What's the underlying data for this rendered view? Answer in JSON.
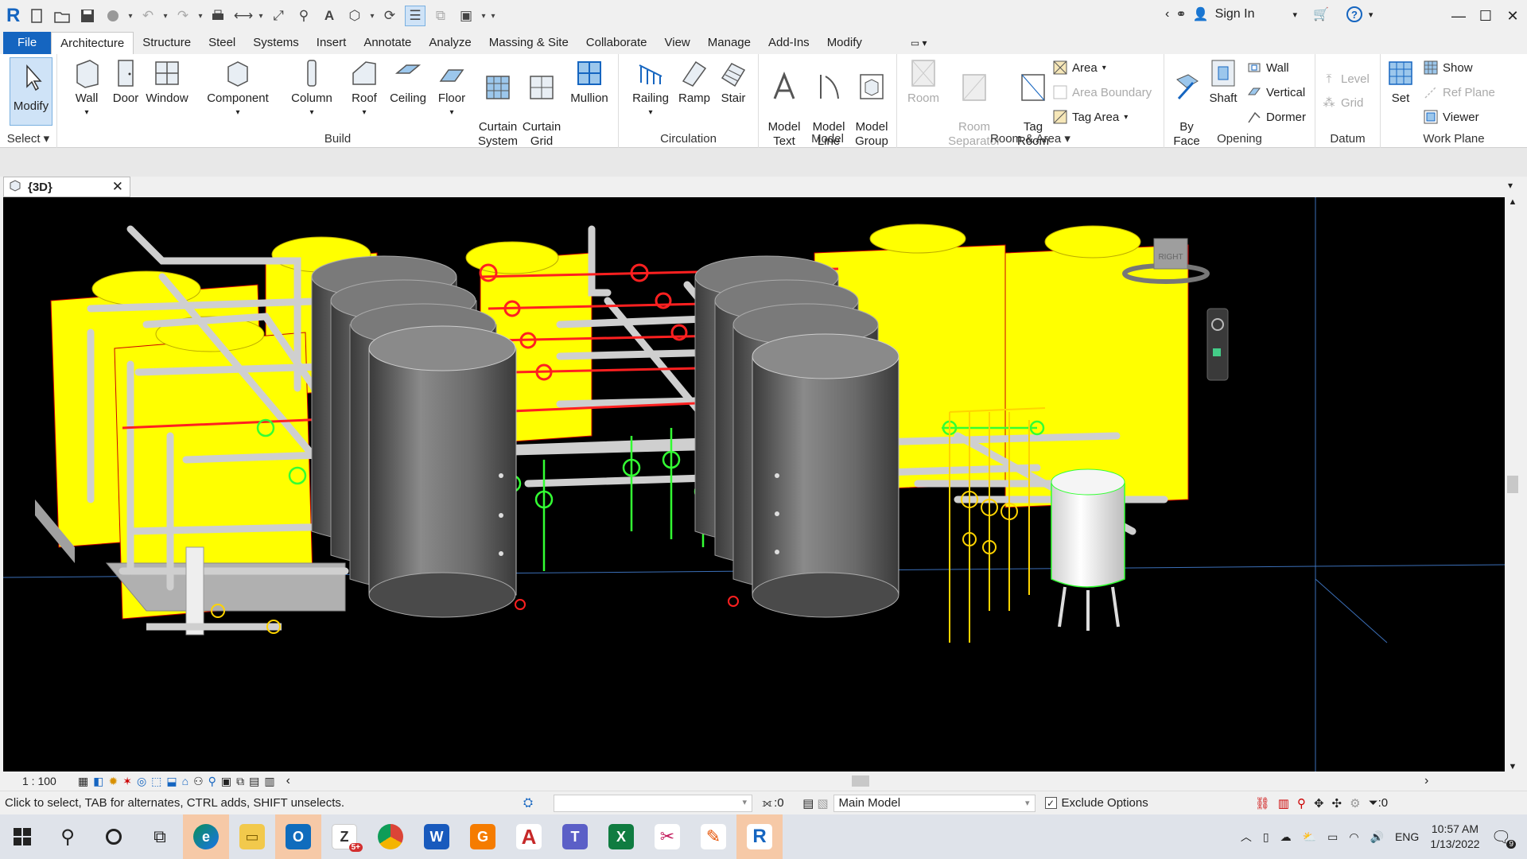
{
  "qat": {
    "help_label": "?",
    "signin": "Sign In"
  },
  "tabs": [
    "File",
    "Architecture",
    "Structure",
    "Steel",
    "Systems",
    "Insert",
    "Annotate",
    "Analyze",
    "Massing & Site",
    "Collaborate",
    "View",
    "Manage",
    "Add-Ins",
    "Modify"
  ],
  "ribbon": {
    "select": {
      "modify": "Modify",
      "select": "Select"
    },
    "build": {
      "label": "Build",
      "tools": [
        "Wall",
        "Door",
        "Window",
        "Component",
        "Column",
        "Roof",
        "Ceiling",
        "Floor",
        "Curtain\nSystem",
        "Curtain\nGrid",
        "Mullion"
      ]
    },
    "circulation": {
      "label": "Circulation",
      "tools": [
        "Railing",
        "Ramp",
        "Stair"
      ]
    },
    "model": {
      "label": "Model",
      "tools": [
        "Model\nText",
        "Model\nLine",
        "Model\nGroup"
      ]
    },
    "room_area": {
      "label": "Room & Area",
      "room": "Room",
      "room_separator": "Room\nSeparator",
      "tag_room": "Tag\nRoom",
      "area": "Area",
      "area_boundary": "Area  Boundary",
      "tag_area": "Tag  Area"
    },
    "opening": {
      "label": "Opening",
      "by_face": "By\nFace",
      "shaft": "Shaft",
      "wall": "Wall",
      "vertical": "Vertical",
      "dormer": "Dormer"
    },
    "datum": {
      "label": "Datum",
      "level": "Level",
      "grid": "Grid"
    },
    "work_plane": {
      "label": "Work Plane",
      "set": "Set",
      "show": "Show",
      "ref_plane": "Ref  Plane",
      "viewer": "Viewer"
    }
  },
  "view": {
    "tab_title": "{3D}",
    "viewcube_label": "RIGHT",
    "scale": "1 : 100"
  },
  "status": {
    "hint": "Click to select, TAB for alternates, CTRL adds, SHIFT unselects.",
    "filter_count": ":0",
    "workset": "Main Model",
    "exclude_options": "Exclude Options",
    "selection_count": ":0"
  },
  "taskbar": {
    "lang": "ENG",
    "time": "10:57 AM",
    "date": "1/13/2022",
    "notif_count": "9",
    "badge": "5+"
  },
  "colors": {
    "accent": "#1565c0",
    "tank": "#6b6b6b",
    "unit": "#ffff00",
    "pipe": "#cfcfcf",
    "valve_red": "#ff2020",
    "valve_green": "#33ff33"
  }
}
